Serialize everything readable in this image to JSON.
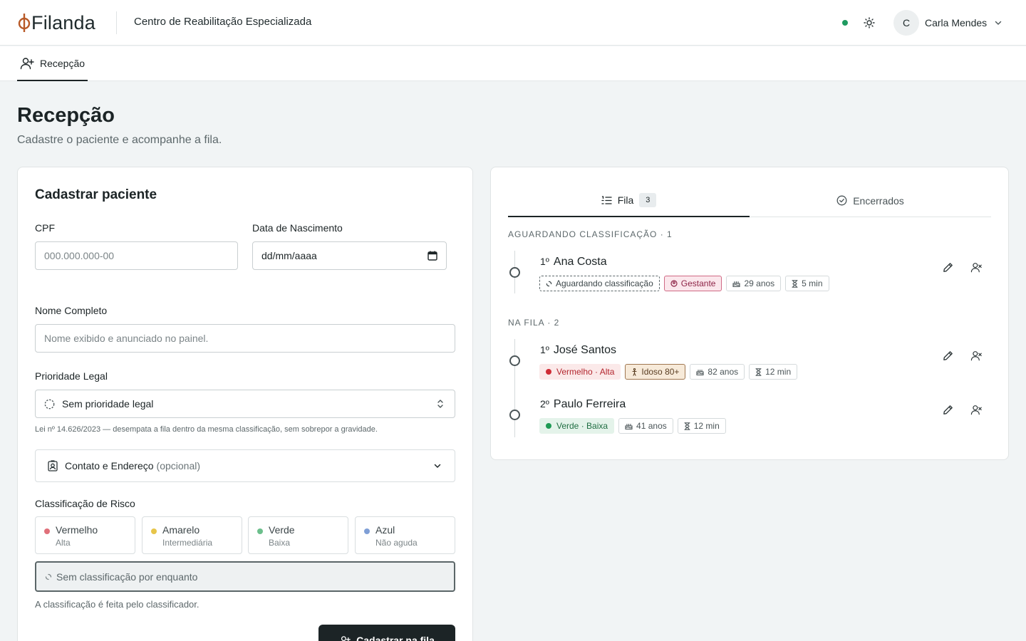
{
  "app": {
    "logo_text": "Filanda",
    "org_name": "Centro de Reabilitação Especializada",
    "user": {
      "initial": "C",
      "name": "Carla Mendes"
    },
    "status_color": "#1e9a60"
  },
  "nav": {
    "tabs": [
      {
        "label": "Recepção",
        "icon": "user-plus-icon",
        "active": true
      }
    ]
  },
  "page": {
    "title": "Recepção",
    "subtitle": "Cadastre o paciente e acompanhe a fila."
  },
  "form": {
    "title": "Cadastrar paciente",
    "cpf": {
      "label": "CPF",
      "placeholder": "000.000.000-00",
      "value": ""
    },
    "birth": {
      "label": "Data de Nascimento",
      "placeholder": "dd/mm/aaaa"
    },
    "name": {
      "label": "Nome Completo",
      "placeholder": "Nome exibido e anunciado no painel."
    },
    "priority": {
      "label": "Prioridade Legal",
      "selected": "Sem prioridade legal",
      "hint": "Lei nº 14.626/2023 — desempata a fila dentro da mesma classificação, sem sobrepor a gravidade."
    },
    "contact": {
      "label": "Contato e Endereço",
      "optional": "(opcional)"
    },
    "risk": {
      "label": "Classificação de Risco",
      "options": [
        {
          "name": "Vermelho",
          "sub": "Alta",
          "color": "#e0707a"
        },
        {
          "name": "Amarelo",
          "sub": "Intermediária",
          "color": "#e7c54a"
        },
        {
          "name": "Verde",
          "sub": "Baixa",
          "color": "#6cbf8c"
        },
        {
          "name": "Azul",
          "sub": "Não aguda",
          "color": "#7f9fd6"
        }
      ],
      "none_label": "Sem classificação por enquanto",
      "hint": "A classificação é feita pelo classificador."
    },
    "submit_label": "Cadastrar na fila"
  },
  "queue": {
    "tabs": {
      "queue_label": "Fila",
      "queue_count": "3",
      "closed_label": "Encerrados"
    },
    "awaiting": {
      "heading": "AGUARDANDO CLASSIFICAÇÃO · 1",
      "items": [
        {
          "position": "1º",
          "name": "Ana Costa",
          "status": "Aguardando classificação",
          "priority": "Gestante",
          "age": "29 anos",
          "wait": "5 min"
        }
      ]
    },
    "in_queue": {
      "heading": "NA FILA · 2",
      "items": [
        {
          "position": "1º",
          "name": "José Santos",
          "risk": "Vermelho · Alta",
          "priority": "Idoso 80+",
          "age": "82 anos",
          "wait": "12 min"
        },
        {
          "position": "2º",
          "name": "Paulo Ferreira",
          "risk": "Verde · Baixa",
          "age": "41 anos",
          "wait": "12 min"
        }
      ]
    }
  }
}
